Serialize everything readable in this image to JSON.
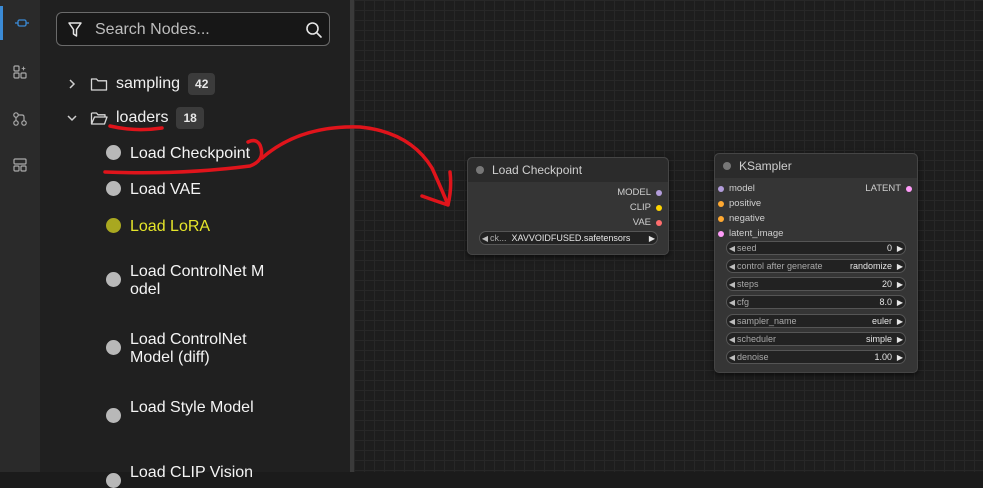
{
  "activity_bar": {
    "items": [
      {
        "icon": "node-library-icon",
        "active": true
      },
      {
        "icon": "model-library-icon",
        "active": false
      },
      {
        "icon": "workflows-icon",
        "active": false
      },
      {
        "icon": "templates-icon",
        "active": false
      }
    ]
  },
  "sidebar": {
    "search": {
      "placeholder": "Search Nodes..."
    },
    "folders": [
      {
        "label": "sampling",
        "count": "42",
        "expanded": false
      },
      {
        "label": "loaders",
        "count": "18",
        "expanded": true
      }
    ],
    "loaders_items": [
      "Load Checkpoint",
      "Load VAE",
      "Load LoRA",
      "Load ControlNet Model",
      "Load ControlNet Model (diff)",
      "Load Style Model",
      "Load CLIP Vision"
    ]
  },
  "nodes": {
    "load_checkpoint": {
      "title": "Load Checkpoint",
      "outputs": [
        {
          "label": "MODEL",
          "color": "#b39ddb"
        },
        {
          "label": "CLIP",
          "color": "#ffd500"
        },
        {
          "label": "VAE",
          "color": "#ff6e6e"
        }
      ],
      "widget": {
        "name": "ck...",
        "value": "XAVVOIDFUSED.safetensors"
      }
    },
    "ksampler": {
      "title": "KSampler",
      "inputs": [
        {
          "label": "model",
          "color": "#b39ddb"
        },
        {
          "label": "positive",
          "color": "#ffa931"
        },
        {
          "label": "negative",
          "color": "#ffa931"
        },
        {
          "label": "latent_image",
          "color": "#ff9cf9"
        }
      ],
      "output": {
        "label": "LATENT",
        "color": "#ff9cf9"
      },
      "widgets": [
        {
          "name": "seed",
          "value": "0"
        },
        {
          "name": "control after generate",
          "value": "randomize"
        },
        {
          "name": "steps",
          "value": "20"
        },
        {
          "name": "cfg",
          "value": "8.0"
        },
        {
          "name": "sampler_name",
          "value": "euler"
        },
        {
          "name": "scheduler",
          "value": "simple"
        },
        {
          "name": "denoise",
          "value": "1.00"
        }
      ]
    }
  },
  "colors": {
    "accent": "#3b8bd6",
    "highlight_text": "#e5e52a",
    "annotation": "#e0141b"
  }
}
